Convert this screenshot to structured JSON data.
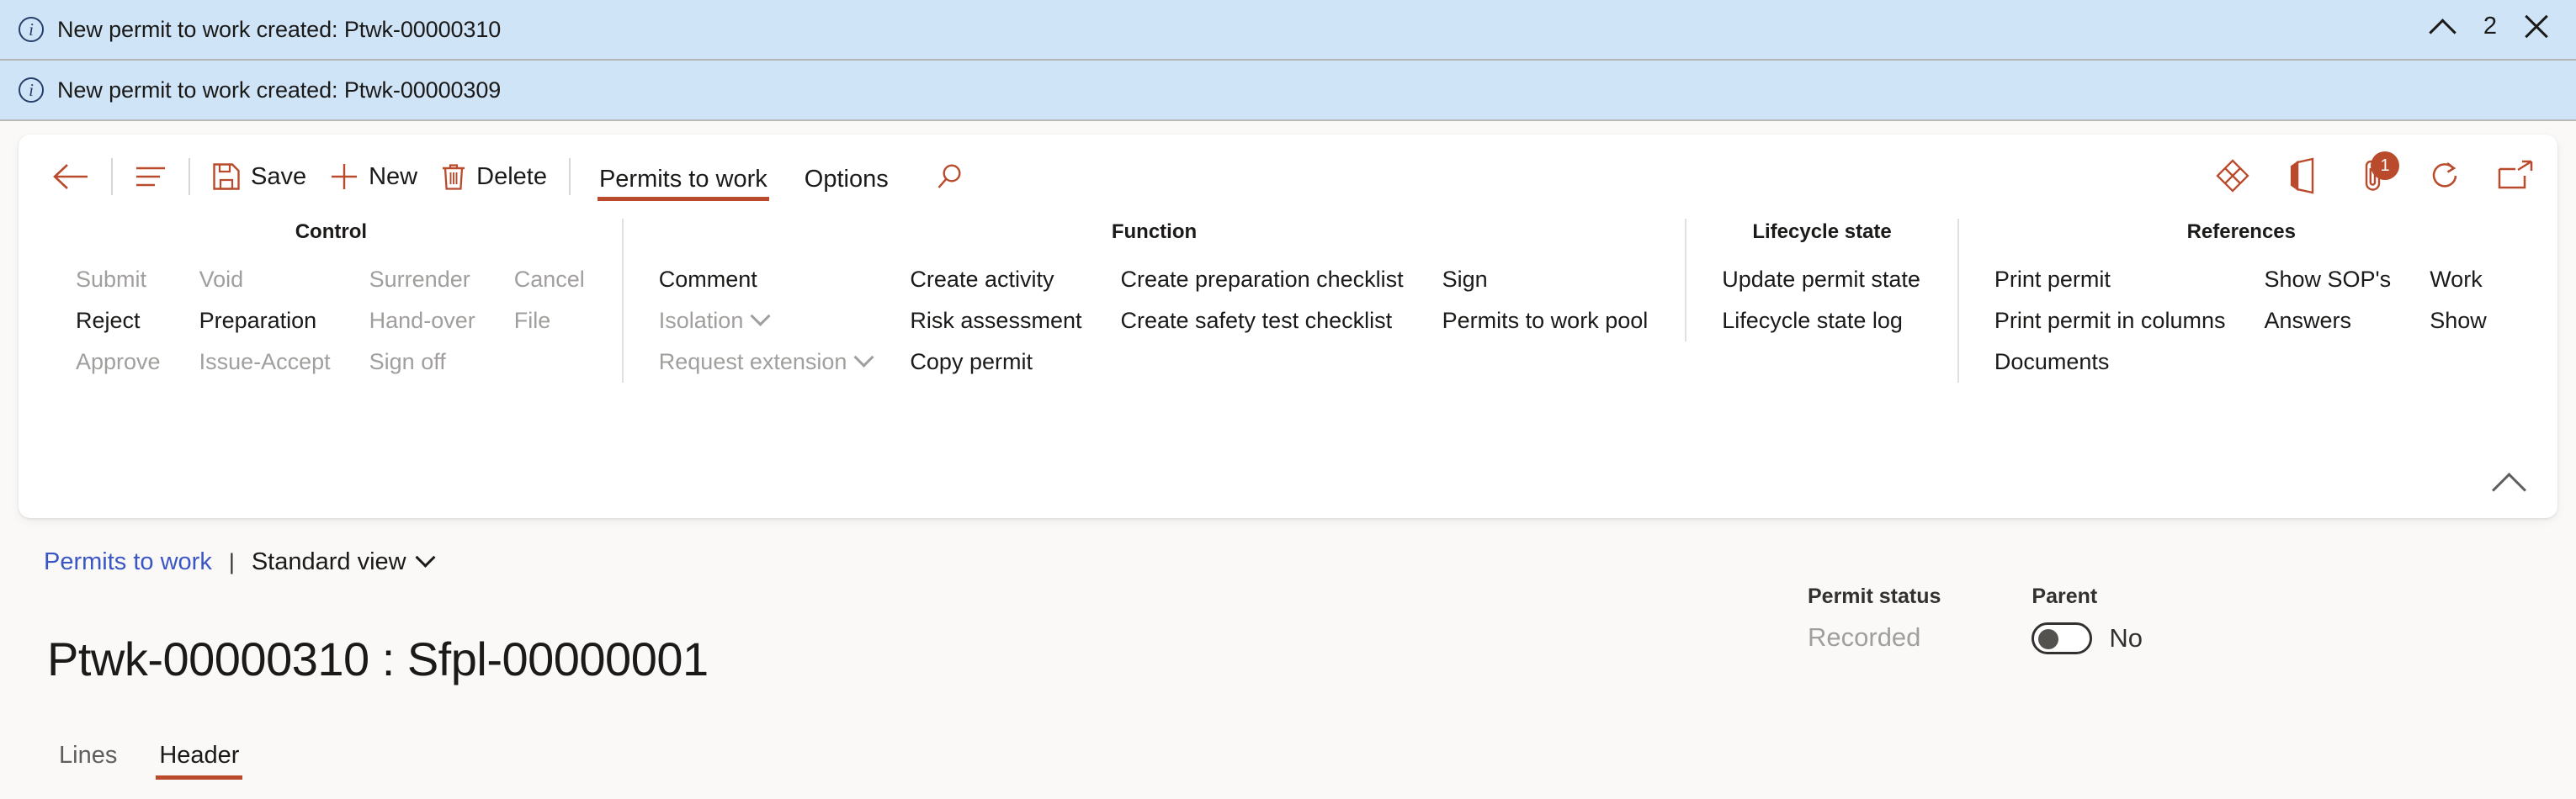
{
  "notifications": {
    "messages": [
      {
        "icon": "info-icon",
        "text": "New permit to work created: Ptwk-00000310"
      },
      {
        "icon": "info-icon",
        "text": "New permit to work created: Ptwk-00000309"
      }
    ],
    "count": "2",
    "collapse_icon": "chevron-up-icon",
    "close_icon": "close-icon",
    "background_color": "#cfe4f7"
  },
  "toolbar": {
    "back_icon": "back-arrow-icon",
    "menu_icon": "show-hide-navigation-icon",
    "save_label": "Save",
    "save_icon": "save-icon",
    "new_label": "New",
    "new_icon": "plus-icon",
    "delete_label": "Delete",
    "delete_icon": "trash-icon",
    "tabs": [
      {
        "label": "Permits to work",
        "selected": true
      },
      {
        "label": "Options",
        "selected": false
      }
    ],
    "search_icon": "search-icon",
    "right_icons": [
      {
        "name": "dynamics-365-icon",
        "badge": ""
      },
      {
        "name": "office-apps-icon",
        "badge": ""
      },
      {
        "name": "attachment-icon",
        "badge": "1"
      },
      {
        "name": "refresh-icon",
        "badge": ""
      },
      {
        "name": "open-in-new-window-icon",
        "badge": ""
      }
    ],
    "accent_color": "#b94a2c"
  },
  "action_pane": {
    "collapse_icon": "chevron-up-icon",
    "groups": [
      {
        "title": "Control",
        "columns": [
          [
            {
              "label": "Submit",
              "disabled": true
            },
            {
              "label": "Reject",
              "disabled": false
            },
            {
              "label": "Approve",
              "disabled": true
            }
          ],
          [
            {
              "label": "Void",
              "disabled": true
            },
            {
              "label": "Preparation",
              "disabled": false
            },
            {
              "label": "Issue-Accept",
              "disabled": true
            }
          ],
          [
            {
              "label": "Surrender",
              "disabled": true
            },
            {
              "label": "Hand-over",
              "disabled": true
            },
            {
              "label": "Sign off",
              "disabled": true
            }
          ],
          [
            {
              "label": "Cancel",
              "disabled": true
            },
            {
              "label": "File",
              "disabled": true
            }
          ]
        ]
      },
      {
        "title": "Function",
        "columns": [
          [
            {
              "label": "Comment",
              "disabled": false
            },
            {
              "label": "Isolation",
              "disabled": true,
              "chevron": true
            },
            {
              "label": "Request extension",
              "disabled": true,
              "chevron": true
            }
          ],
          [
            {
              "label": "Create activity",
              "disabled": false
            },
            {
              "label": "Risk assessment",
              "disabled": false
            },
            {
              "label": "Copy permit",
              "disabled": false
            }
          ],
          [
            {
              "label": "Create preparation checklist",
              "disabled": false
            },
            {
              "label": "Create safety test checklist",
              "disabled": false
            }
          ],
          [
            {
              "label": "Sign",
              "disabled": false
            },
            {
              "label": "Permits to work pool",
              "disabled": false
            }
          ]
        ]
      },
      {
        "title": "Lifecycle state",
        "columns": [
          [
            {
              "label": "Update permit state",
              "disabled": false
            },
            {
              "label": "Lifecycle state log",
              "disabled": false
            }
          ]
        ]
      },
      {
        "title": "References",
        "columns": [
          [
            {
              "label": "Print permit",
              "disabled": false
            },
            {
              "label": "Print permit in columns",
              "disabled": false
            },
            {
              "label": "Documents",
              "disabled": false
            }
          ],
          [
            {
              "label": "Show SOP's",
              "disabled": false
            },
            {
              "label": "Answers",
              "disabled": false
            }
          ],
          [
            {
              "label": "Work",
              "disabled": false
            },
            {
              "label": "Show",
              "disabled": false
            }
          ]
        ]
      }
    ]
  },
  "breadcrumb": {
    "link_label": "Permits to work",
    "separator": "|",
    "view_label": "Standard view",
    "view_chevron_icon": "chevron-down-icon",
    "link_color": "#3a56c4"
  },
  "header": {
    "title": "Ptwk-00000310 : Sfpl-00000001",
    "fields": [
      {
        "label": "Permit status",
        "value": "Recorded"
      }
    ],
    "parent": {
      "label": "Parent",
      "toggle_state": "off",
      "toggle_value": "No"
    }
  },
  "page_tabs": [
    {
      "label": "Lines",
      "selected": false
    },
    {
      "label": "Header",
      "selected": true
    }
  ]
}
